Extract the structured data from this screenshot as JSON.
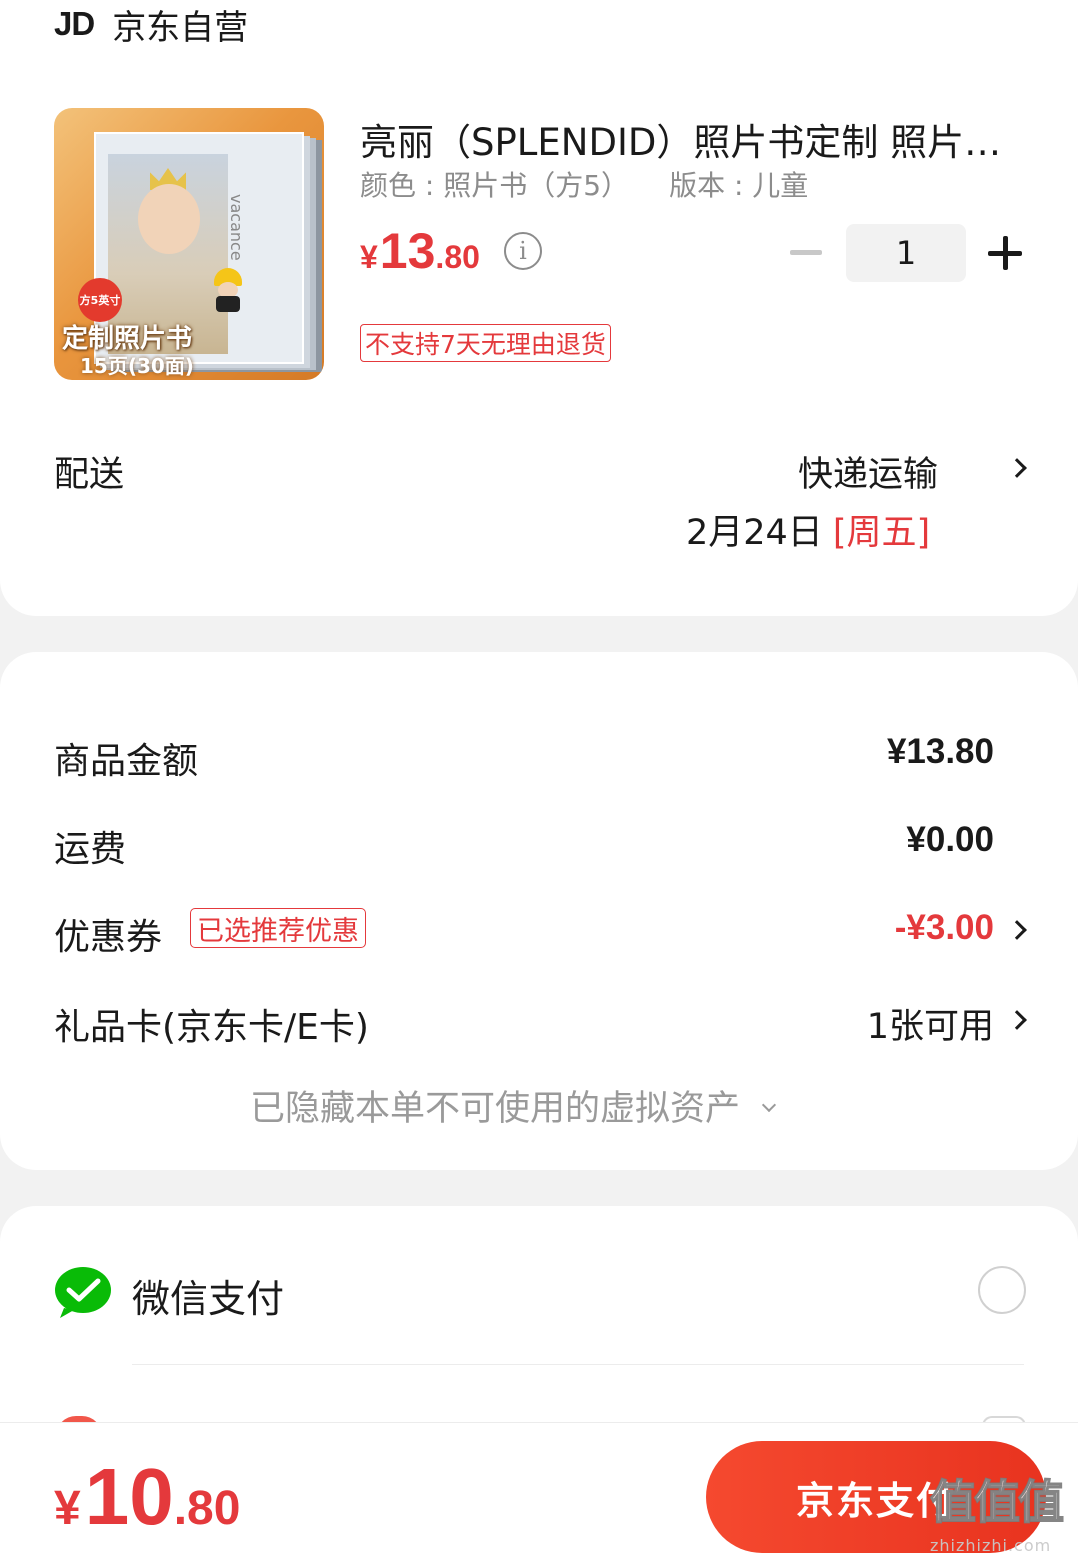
{
  "store": {
    "logo_text": "JD",
    "name": "京东自营"
  },
  "product": {
    "title": "亮丽（SPLENDID）照片书定制 照片书 相册定制",
    "color_label": "颜色 : 照片书（方5）",
    "version_label": "版本 : 儿童",
    "price_currency": "¥",
    "price_integer": "13",
    "price_decimal": ".80",
    "quantity": "1",
    "return_policy_tag": "不支持7天无理由退货",
    "thumbnail": {
      "badge": "方5英寸",
      "caption_title": "定制照片书",
      "caption_sub": "15页(30面)",
      "spine_text": "vacance"
    }
  },
  "delivery": {
    "label": "配送",
    "method": "快递运输",
    "date": "2月24日",
    "weekday": "[周五]"
  },
  "summary": {
    "goods_amount_label": "商品金额",
    "goods_amount_value": "¥13.80",
    "shipping_label": "运费",
    "shipping_value": "¥0.00",
    "coupon_label": "优惠券",
    "coupon_tag": "已选推荐优惠",
    "coupon_value": "-¥3.00",
    "gift_card_label": "礼品卡(京东卡/E卡)",
    "gift_card_value": "1张可用",
    "hidden_assets_text": "已隐藏本单不可使用的虚拟资产"
  },
  "payment": {
    "wechat_label": "微信支付"
  },
  "bottom": {
    "total_currency": "¥",
    "total_integer": "10",
    "total_decimal": ".80",
    "pay_button_label": "京东支付"
  },
  "watermark": {
    "chars": "值值值",
    "url": "zhizhizhi.com"
  },
  "colors": {
    "accent_red": "#e4393c",
    "wechat_green": "#09bb07",
    "button_red": "#f5492f"
  }
}
